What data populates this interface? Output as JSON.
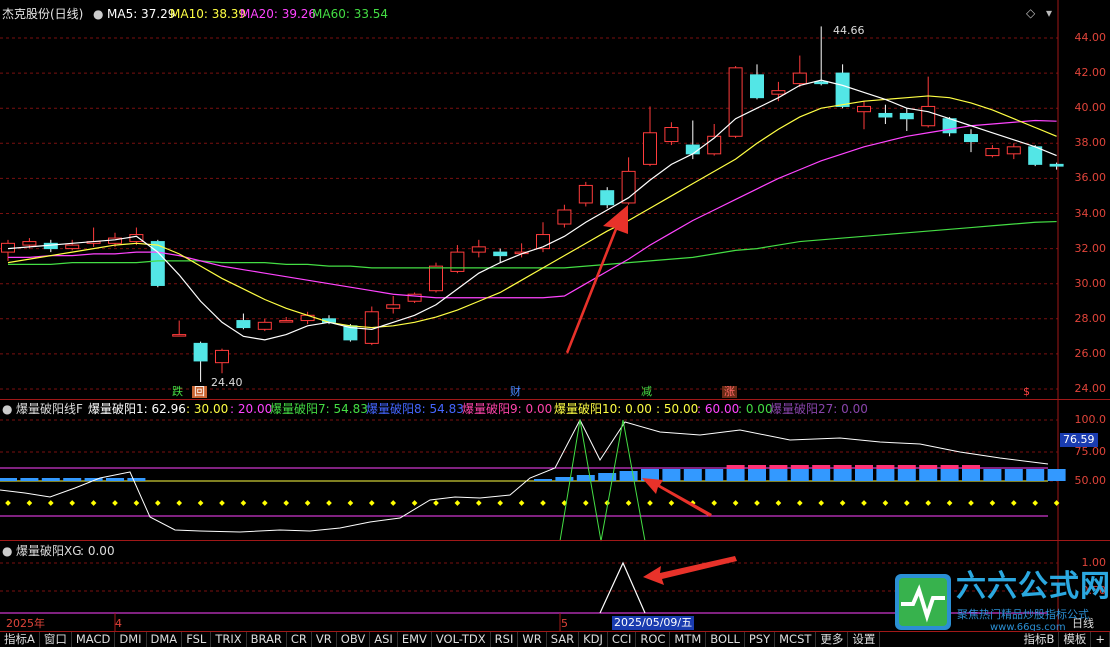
{
  "header": {
    "stock_title": "杰克股份(日线)",
    "ma5": "MA5: 37.29",
    "ma10": "MA10: 38.39",
    "ma20": "MA20: 39.26",
    "ma60": "MA60: 33.54",
    "colors": {
      "ma5": "#ffffff",
      "ma10": "#ffff44",
      "ma20": "#ff44ff",
      "ma60": "#44dd44"
    }
  },
  "price_axis": [
    "44.00",
    "42.00",
    "40.00",
    "38.00",
    "36.00",
    "34.00",
    "32.00",
    "30.00",
    "28.00",
    "26.00",
    "24.00"
  ],
  "annotations": {
    "high": "44.66",
    "low": "24.40",
    "event_tags": [
      "跌",
      "回",
      "财",
      "减",
      "涨"
    ],
    "dollar_mark": "$"
  },
  "indicator1": {
    "name": "爆量破阳线F",
    "v1": "爆量破阳1: 62.96",
    "v2": ": 30.00",
    "v3": ": 20.00",
    "v7": "爆量破阳7: 54.83",
    "v8": "爆量破阳8: 54.83",
    "v9": "爆量破阳9: 0.00",
    "v10": "爆量破阳10: 0.00",
    "v11": ": 50.00",
    "v12": ": 60.00",
    "v13": ": 0.00",
    "v27": "爆量破阳27: 0.00",
    "axis": [
      "100.0",
      "75.00",
      "50.00"
    ],
    "current_value": "76.59"
  },
  "indicator2": {
    "name": "爆量破阳XG",
    "value": ": 0.00",
    "axis": [
      "1.00",
      "0.50"
    ]
  },
  "date_axis": {
    "year": "2025年",
    "month4": "4",
    "month5": "5",
    "selected_date": "2025/05/09/五",
    "right_label": "日线"
  },
  "toolbar": {
    "items": [
      "指标A",
      "窗口",
      "MACD",
      "DMI",
      "DMA",
      "FSL",
      "TRIX",
      "BRAR",
      "CR",
      "VR",
      "OBV",
      "ASI",
      "EMV",
      "VOL-TDX",
      "RSI",
      "WR",
      "SAR",
      "KDJ",
      "CCI",
      "ROC",
      "MTM",
      "BOLL",
      "PSY",
      "MCST",
      "更多",
      "设置"
    ],
    "right_items": [
      "指标B",
      "模板",
      "+"
    ]
  },
  "watermark": {
    "brand": "六六公式网",
    "slogan": "聚焦热门精品炒股指标公式",
    "url": "www.66gs.com"
  }
}
